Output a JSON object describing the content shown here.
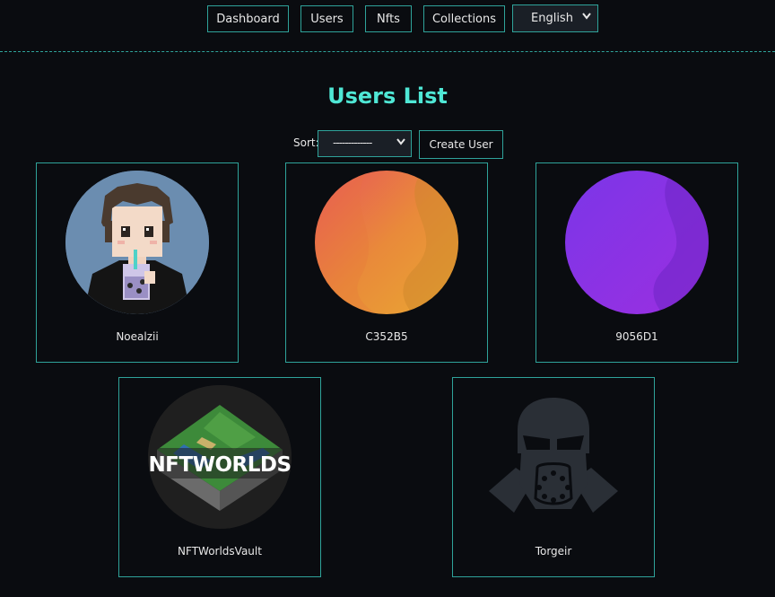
{
  "nav": {
    "dashboard": "Dashboard",
    "users": "Users",
    "nfts": "Nfts",
    "collections": "Collections",
    "language": "English"
  },
  "page": {
    "title": "Users List"
  },
  "controls": {
    "sort_label": "Sort:",
    "sort_value": "-------------",
    "create_user": "Create User"
  },
  "users": [
    {
      "name": "Noealzii",
      "avatar": "pixel-character"
    },
    {
      "name": "C352B5",
      "avatar": "orange-gradient"
    },
    {
      "name": "9056D1",
      "avatar": "purple-gradient"
    },
    {
      "name": "NFTWorldsVault",
      "avatar": "nftworlds-logo"
    },
    {
      "name": "Torgeir",
      "avatar": "gasmask-icon"
    }
  ],
  "logo_text": "NFTWORLDS",
  "colors": {
    "accent": "#2fa39a",
    "title": "#4fe7d5",
    "background": "#0a0c10"
  }
}
